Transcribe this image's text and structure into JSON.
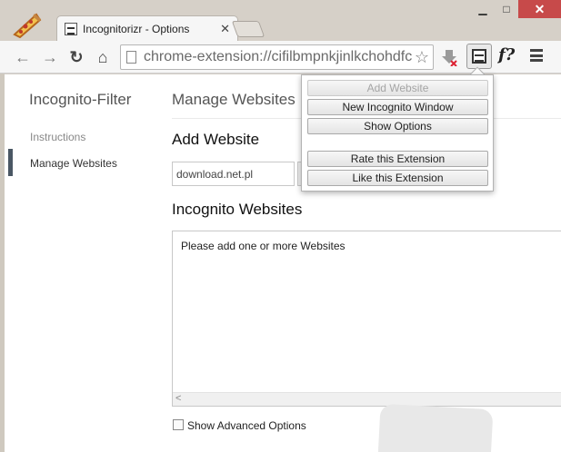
{
  "window": {
    "controls": {
      "minimize": "▁",
      "maximize": "□",
      "close": "✕"
    }
  },
  "tab": {
    "title": "Incognitorizr - Options",
    "close_glyph": "✕"
  },
  "toolbar": {
    "back_glyph": "←",
    "forward_glyph": "→",
    "reload_glyph": "↻",
    "home_glyph": "⌂",
    "url": "chrome-extension://cifilbmpnkjinlkchohdfc",
    "star_glyph": "☆",
    "f_ext_label": "f?"
  },
  "sidebar": {
    "title": "Incognito-Filter",
    "items": [
      {
        "label": "Instructions"
      },
      {
        "label": "Manage Websites"
      }
    ]
  },
  "main": {
    "title": "Manage Websites",
    "add_heading": "Add Website",
    "add_input_value": "download.net.pl",
    "list_heading": "Incognito Websites",
    "list_placeholder": "Please add one or more Websites",
    "scroll_arrow": "<",
    "advanced_label": "Show Advanced Options"
  },
  "popup": {
    "buttons": [
      {
        "label": "Add Website",
        "disabled": true
      },
      {
        "label": "New Incognito Window",
        "disabled": false
      },
      {
        "label": "Show Options",
        "disabled": false
      },
      {
        "label": "Rate this Extension",
        "disabled": false
      },
      {
        "label": "Like this Extension",
        "disabled": false
      }
    ]
  },
  "colors": {
    "close_button": "#c74a4a",
    "sidebar_marker": "#4a5764",
    "frame": "#d6d0c8"
  },
  "icons": [
    "pizza-icon",
    "incognito-page-icon",
    "page-icon",
    "star-icon",
    "download-blocked-icon",
    "incognito-extension-icon",
    "hamburger-menu-icon"
  ]
}
